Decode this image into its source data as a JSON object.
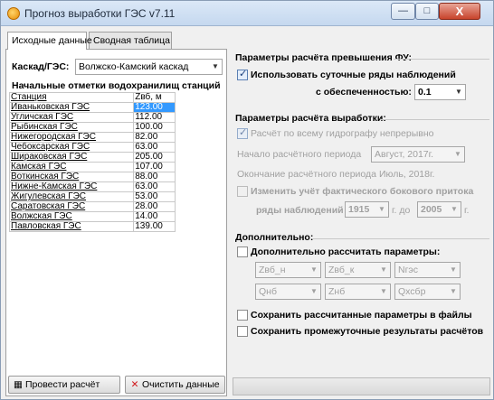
{
  "window": {
    "title": "Прогноз выработки ГЭС v7.11",
    "min_glyph": "—",
    "max_glyph": "□",
    "close_glyph": "X"
  },
  "tabs": [
    {
      "label": "Исходные данные",
      "active": true
    },
    {
      "label": "Сводная таблица",
      "active": false
    }
  ],
  "left": {
    "cascade_label": "Каскад/ГЭС:",
    "cascade_value": "Волжско-Камский каскад",
    "marks_heading": "Начальные отметки водохранилищ станций",
    "table": {
      "headers": [
        "Станция",
        "Zвб, м"
      ],
      "rows": [
        [
          "Иваньковская ГЭС",
          "123.00"
        ],
        [
          "Угличская ГЭС",
          "112.00"
        ],
        [
          "Рыбинская ГЭС",
          "100.00"
        ],
        [
          "Нижегородская ГЭС",
          "82.00"
        ],
        [
          "Чебоксарская ГЭС",
          "63.00"
        ],
        [
          "Шираковская ГЭС",
          "205.00"
        ],
        [
          "Камская ГЭС",
          "107.00"
        ],
        [
          "Воткинская ГЭС",
          "88.00"
        ],
        [
          "Нижне-Камская ГЭС",
          "63.00"
        ],
        [
          "Жигулевская ГЭС",
          "53.00"
        ],
        [
          "Саратовская ГЭС",
          "28.00"
        ],
        [
          "Волжская ГЭС",
          "14.00"
        ],
        [
          "Павловская ГЭС",
          "139.00"
        ]
      ]
    },
    "run_button": "Провести расчёт",
    "clear_button": "Очистить данные"
  },
  "right": {
    "excess_title": "Параметры расчёта превышения ФУ:",
    "use_daily_label": "Использовать суточные ряды наблюдений",
    "probability_label": "с обеспеченностью:",
    "probability_value": "0.1",
    "output_title": "Параметры расчёта выработки:",
    "whole_hydro_label": "Расчёт по всему гидрографу непрерывно",
    "start_label": "Начало расчётного периода",
    "start_value": "Август, 2017г.",
    "end_label": "Окончание расчётного периода",
    "end_value": "Июль, 2018г.",
    "lateral_label": "Изменить учёт фактического бокового притока",
    "years_label": "ряды наблюдений с",
    "year_from": "1915",
    "to_label": "г. до",
    "year_to": "2005",
    "year_suffix": "г.",
    "extra_title": "Дополнительно:",
    "extra_params_label": "Дополнительно рассчитать параметры:",
    "param_combos": [
      "Zвб_н",
      "Zвб_к",
      "Nгэс",
      "Qнб",
      "Zнб",
      "Qхсбр"
    ],
    "save_params_label": "Сохранить рассчитанные параметры в файлы",
    "save_intermediate_label": "Сохранить промежуточные результаты расчётов"
  }
}
